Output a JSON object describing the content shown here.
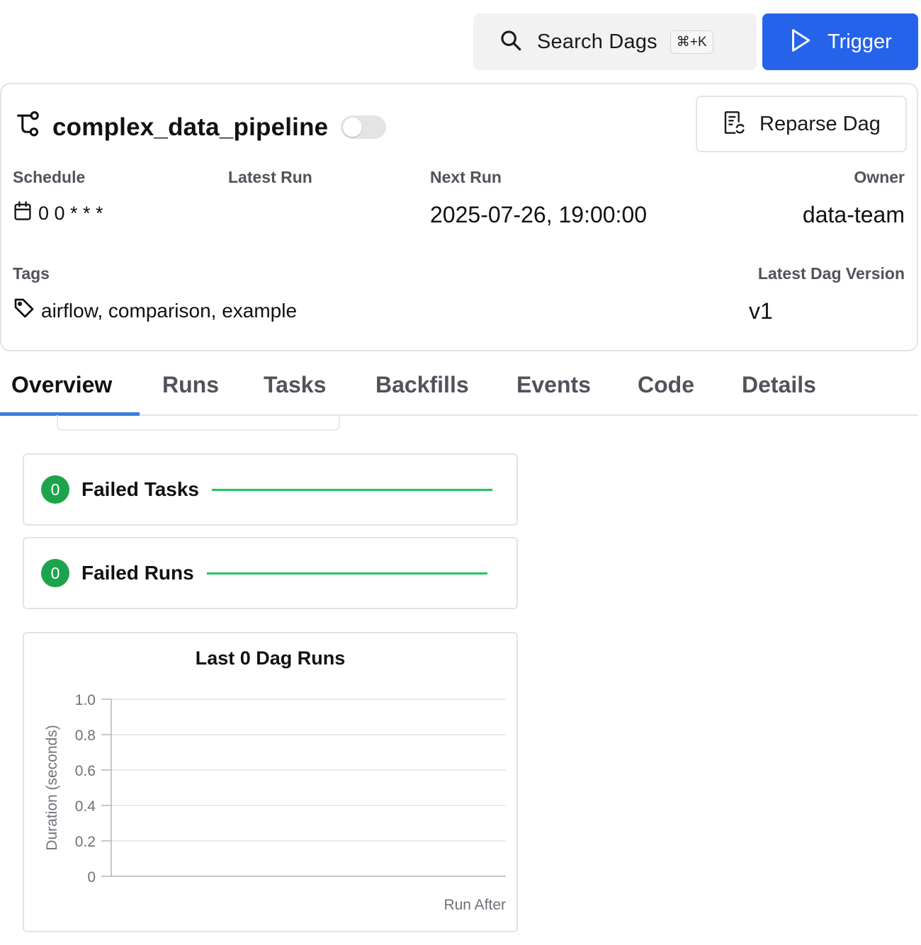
{
  "topbar": {
    "search_label": "Search Dags",
    "search_shortcut": "⌘+K",
    "trigger_label": "Trigger",
    "accent_color": "#2563eb"
  },
  "dag": {
    "title": "complex_data_pipeline",
    "paused": true,
    "reparse_label": "Reparse Dag",
    "schedule_label": "Schedule",
    "schedule_value": "0 0 * * *",
    "latest_run_label": "Latest Run",
    "latest_run_value": "",
    "next_run_label": "Next Run",
    "next_run_value": "2025-07-26, 19:00:00",
    "owner_label": "Owner",
    "owner_value": "data-team",
    "tags_label": "Tags",
    "tags_value": "airflow, comparison, example",
    "version_label": "Latest Dag Version",
    "version_value": "v1"
  },
  "tabs": [
    {
      "label": "Overview",
      "active": true
    },
    {
      "label": "Runs",
      "active": false
    },
    {
      "label": "Tasks",
      "active": false
    },
    {
      "label": "Backfills",
      "active": false
    },
    {
      "label": "Events",
      "active": false
    },
    {
      "label": "Code",
      "active": false
    },
    {
      "label": "Details",
      "active": false
    }
  ],
  "stats": {
    "failed_tasks": {
      "count": "0",
      "label": "Failed Tasks"
    },
    "failed_runs": {
      "count": "0",
      "label": "Failed Runs"
    },
    "success_color": "#22c55e"
  },
  "chart_data": {
    "type": "bar",
    "title": "Last 0 Dag Runs",
    "xlabel": "Run After",
    "ylabel": "Duration (seconds)",
    "categories": [],
    "values": [],
    "ylim": [
      0,
      1.0
    ],
    "yticks": [
      "0",
      "0.2",
      "0.4",
      "0.6",
      "0.8",
      "1.0"
    ],
    "grid": true
  }
}
